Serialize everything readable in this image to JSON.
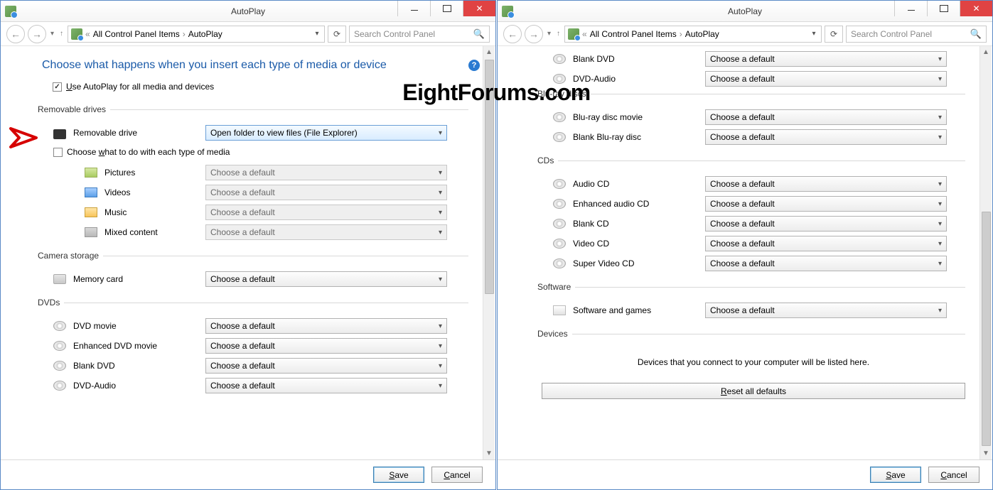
{
  "watermark": "EightForums.com",
  "win": {
    "title": "AutoPlay",
    "crumb_prev": "All Control Panel Items",
    "crumb_here": "AutoPlay",
    "search_placeholder": "Search Control Panel"
  },
  "left": {
    "heading": "Choose what happens when you insert each type of media or device",
    "chk_use_label_pre": "U",
    "chk_use_label_post": "se AutoPlay for all media and devices",
    "grp_removable": "Removable drives",
    "row_removable": "Removable drive",
    "dd_removable_val": "Open folder to view files (File Explorer)",
    "chk_type_pre": "Choose ",
    "chk_type_u": "w",
    "chk_type_post": "hat to do with each type of media",
    "row_pictures": "Pictures",
    "row_videos": "Videos",
    "row_music": "Music",
    "row_mixed": "Mixed content",
    "grp_camera": "Camera storage",
    "row_memory": "Memory card",
    "grp_dvds": "DVDs",
    "row_dvd_movie": "DVD movie",
    "row_enh_dvd": "Enhanced DVD movie",
    "row_blank_dvd": "Blank DVD",
    "row_dvd_audio": "DVD-Audio",
    "choose_default": "Choose a default"
  },
  "right": {
    "row_blank_dvd": "Blank DVD",
    "row_dvd_audio": "DVD-Audio",
    "grp_bluray": "Blu-ray discs",
    "row_bd_movie": "Blu-ray disc movie",
    "row_blank_bd": "Blank Blu-ray disc",
    "grp_cds": "CDs",
    "row_audio_cd": "Audio CD",
    "row_enh_cd": "Enhanced audio CD",
    "row_blank_cd": "Blank CD",
    "row_video_cd": "Video CD",
    "row_svcd": "Super Video CD",
    "grp_software": "Software",
    "row_software": "Software and games",
    "grp_devices": "Devices",
    "devices_msg": "Devices that you connect to your computer will be listed here.",
    "reset_pre": "R",
    "reset_post": "eset all defaults",
    "choose_default": "Choose a default"
  },
  "footer": {
    "save_pre": "S",
    "save_post": "ave",
    "cancel_pre": "C",
    "cancel_post": "ancel"
  }
}
